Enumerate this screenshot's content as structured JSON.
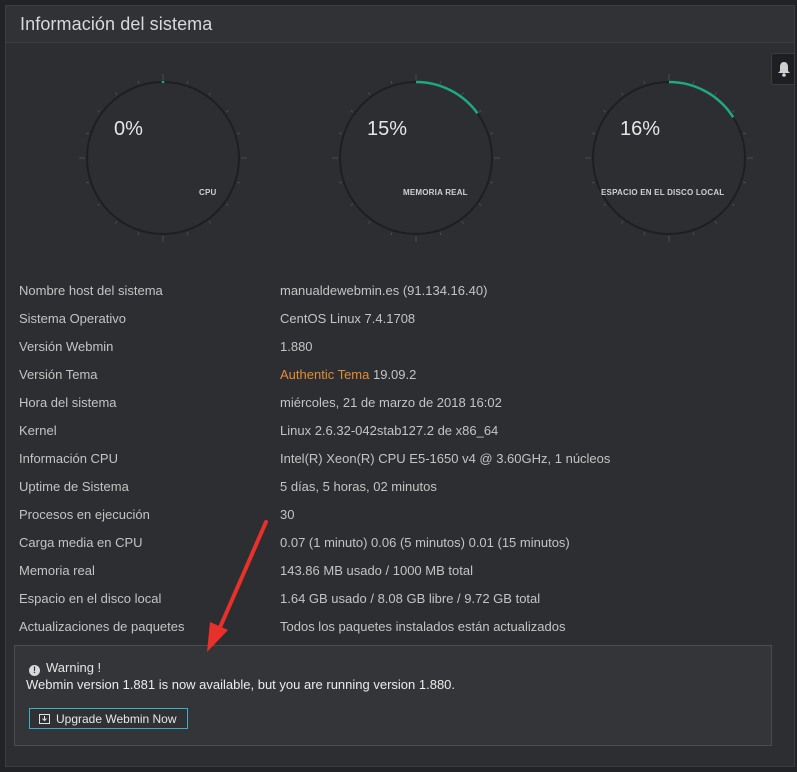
{
  "panel": {
    "title": "Información del sistema"
  },
  "gauges": [
    {
      "percent": 0,
      "percent_text": "0%",
      "label": "CPU"
    },
    {
      "percent": 15,
      "percent_text": "15%",
      "label": "MEMORIA REAL"
    },
    {
      "percent": 16,
      "percent_text": "16%",
      "label": "ESPACIO EN EL DISCO LOCAL"
    }
  ],
  "colors": {
    "accent": "#e38c36",
    "gauge_arc": "#1fa882",
    "annotation_arrow": "#e8312a",
    "button_border": "#3ab0c2"
  },
  "info": {
    "hostname": {
      "label": "Nombre host del sistema",
      "value": "manualdewebmin.es (91.134.16.40)"
    },
    "os": {
      "label": "Sistema Operativo",
      "value": "CentOS Linux 7.4.1708"
    },
    "webmin_version": {
      "label": "Versión Webmin",
      "value": "1.880"
    },
    "theme_version": {
      "label": "Versión Tema",
      "link": "Authentic Tema",
      "value": " 19.09.2"
    },
    "system_time": {
      "label": "Hora del sistema",
      "value": "miércoles, 21 de marzo de 2018 16:02"
    },
    "kernel": {
      "label": "Kernel",
      "value": "Linux 2.6.32-042stab127.2 de x86_64"
    },
    "cpu_info": {
      "label": "Información CPU",
      "value": "Intel(R) Xeon(R) CPU E5-1650 v4 @ 3.60GHz, 1 núcleos"
    },
    "uptime": {
      "label": "Uptime de Sistema",
      "value": "5 días, 5 horas, 02 minutos"
    },
    "processes": {
      "label": "Procesos en ejecución",
      "value": "30"
    },
    "load_avg": {
      "label": "Carga media en CPU",
      "value": "0.07 (1 minuto) 0.06 (5 minutos) 0.01 (15 minutos)"
    },
    "memory": {
      "label": "Memoria real",
      "value": "143.86 MB usado / 1000 MB total"
    },
    "disk": {
      "label": "Espacio en el disco local",
      "value": "1.64 GB usado / 8.08 GB libre / 9.72 GB total"
    },
    "packages": {
      "label": "Actualizaciones de paquetes",
      "value": "Todos los paquetes instalados están actualizados"
    }
  },
  "warning": {
    "title": "Warning !",
    "message": "Webmin version 1.881 is now available, but you are running version 1.880.",
    "button_label": "Upgrade Webmin Now"
  }
}
